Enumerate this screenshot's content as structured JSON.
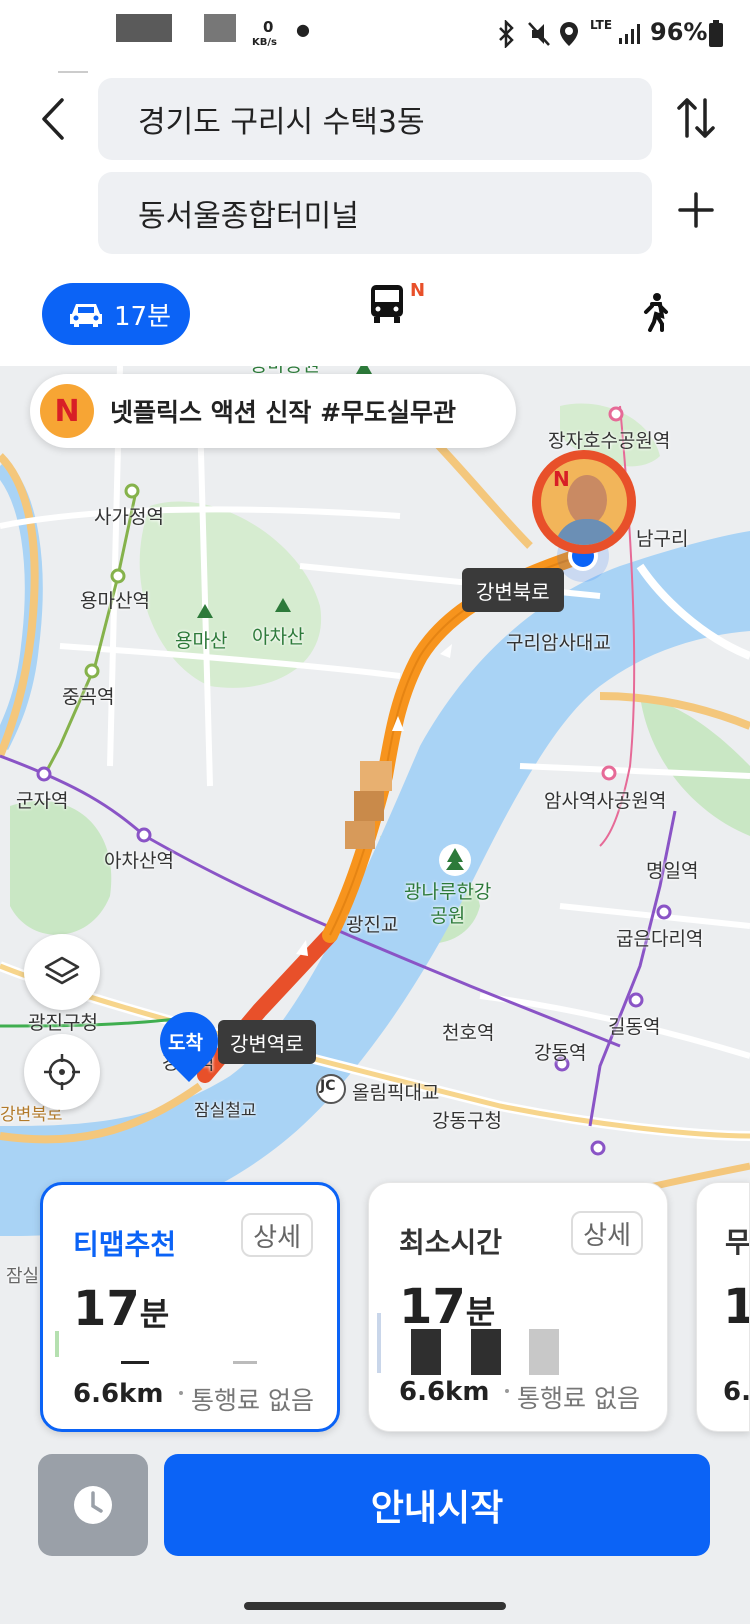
{
  "status_bar": {
    "speed_value": "0",
    "speed_unit": "KB/s",
    "network": "LTE",
    "battery": "96%"
  },
  "header": {
    "origin": "경기도 구리시 수택3동",
    "destination": "동서울종합터미널"
  },
  "modes": {
    "car_label": "17분",
    "bus_badge": "N"
  },
  "map": {
    "ad_banner": "넷플릭스 액션 신작 #무도실무관",
    "ad_logo": "N",
    "ad_marker_logo": "N",
    "labels": {
      "yongma_park": "용마공원",
      "jangja_lake": "장자호수공원역",
      "namguri": "남구리",
      "sagajeong": "사가정역",
      "gangbyeon_bukro_tag": "강변북로",
      "yongmasan_stn": "용마산역",
      "yongmasan": "용마산",
      "achasan": "아차산",
      "guri_amsa_bridge": "구리암사대교",
      "junggok": "중곡역",
      "gunja": "군자역",
      "amsa_park": "암사역사공원역",
      "achasan_stn": "아차산역",
      "myeongil": "명일역",
      "gwangnaru_park": "광나루한강\n공원",
      "gwangjin_bridge": "광진교",
      "gubeun": "굽은다리역",
      "gwangjin_gu": "광진구청",
      "gangbyeon_stn": "강변역로",
      "arrival": "도착",
      "gangbyeon": "강변역",
      "cheonho": "천호역",
      "gildong": "길동역",
      "gangdong": "강동역",
      "olympic_bridge": "올림픽대교",
      "jc": "JC",
      "jamsil_bridge": "잠실철교",
      "gangdong_gu": "강동구청",
      "gangbyeon_road_vertical": "강변북로",
      "gangbyeon_bukro_left": "강변북로",
      "jamsil_left": "잠실"
    }
  },
  "routes": [
    {
      "title": "티맵추천",
      "detail": "상세",
      "time_num": "17",
      "time_unit": "분",
      "distance": "6.6km",
      "toll": "통행료 없음",
      "selected": true
    },
    {
      "title": "최소시간",
      "detail": "상세",
      "time_num": "17",
      "time_unit": "분",
      "distance": "6.6km",
      "toll": "통행료 없음",
      "selected": false
    },
    {
      "title": "무",
      "time_num": "1",
      "distance": "6."
    }
  ],
  "footer": {
    "start_label": "안내시작"
  },
  "colors": {
    "accent": "#0b63f6",
    "route_orange": "#f7941d",
    "route_red": "#e8502a",
    "water": "#a9d3f5",
    "park": "#c9e7c4"
  }
}
